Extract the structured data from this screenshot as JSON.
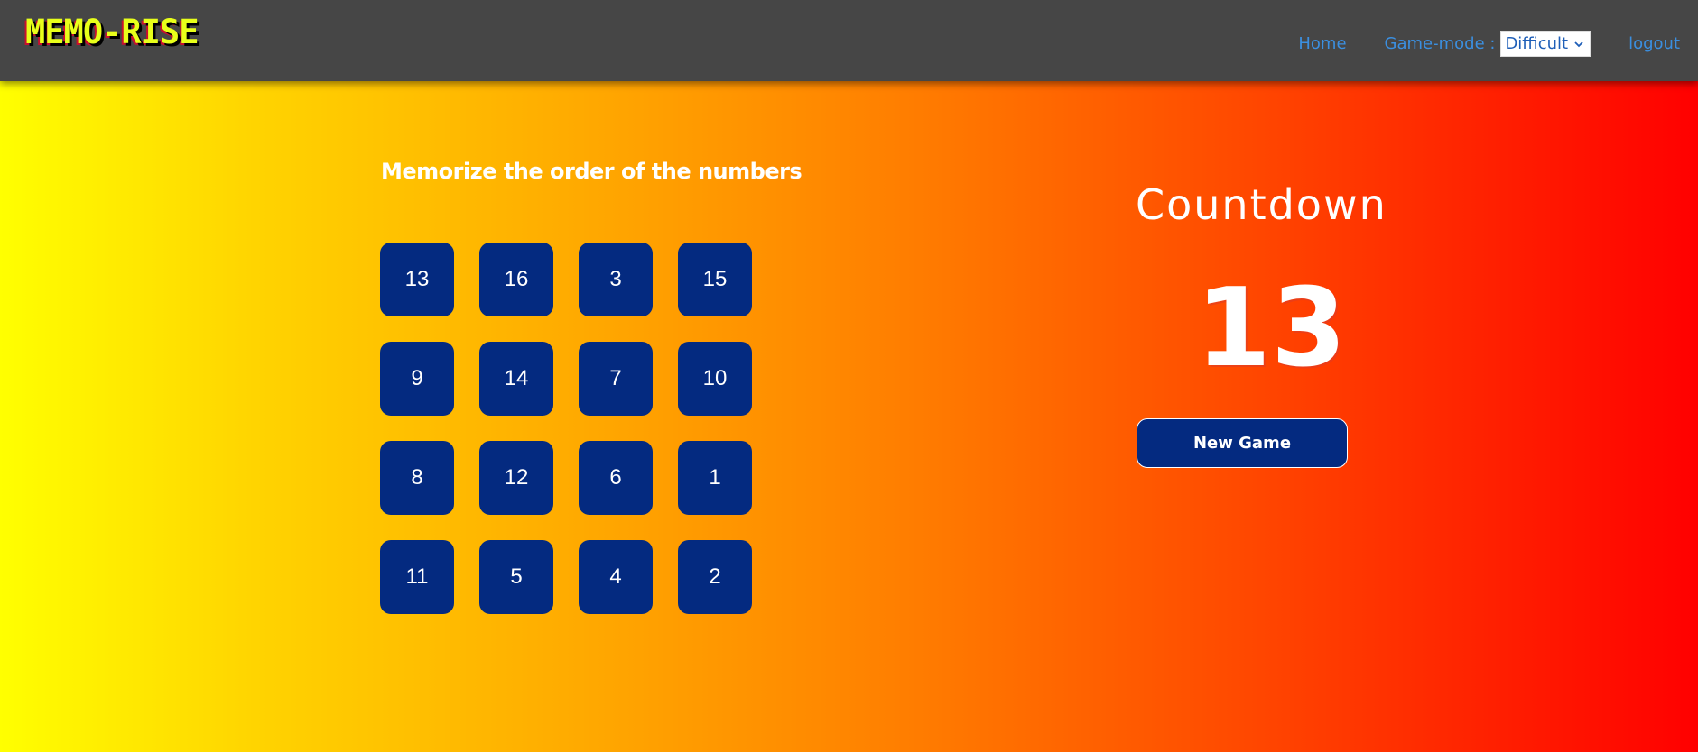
{
  "header": {
    "logo": "MEMO-RISE",
    "nav": {
      "home": "Home",
      "game_mode_label": "Game-mode :",
      "game_mode_selected": "Difficult",
      "logout": "logout"
    }
  },
  "main": {
    "instruction": "Memorize the order of the numbers",
    "tiles": [
      "13",
      "16",
      "3",
      "15",
      "9",
      "14",
      "7",
      "10",
      "8",
      "12",
      "6",
      "1",
      "11",
      "5",
      "4",
      "2"
    ]
  },
  "side": {
    "countdown_title": "Countdown",
    "countdown_value": "13",
    "new_game_label": "New Game"
  },
  "colors": {
    "navbar": "#464646",
    "tile": "#042a80",
    "link": "#3b8fe0",
    "logo": "#e8ff1a",
    "gradient_start": "#ffff00",
    "gradient_end": "#ff0000"
  },
  "icons": {
    "select_arrow": "chevron-down-icon"
  }
}
